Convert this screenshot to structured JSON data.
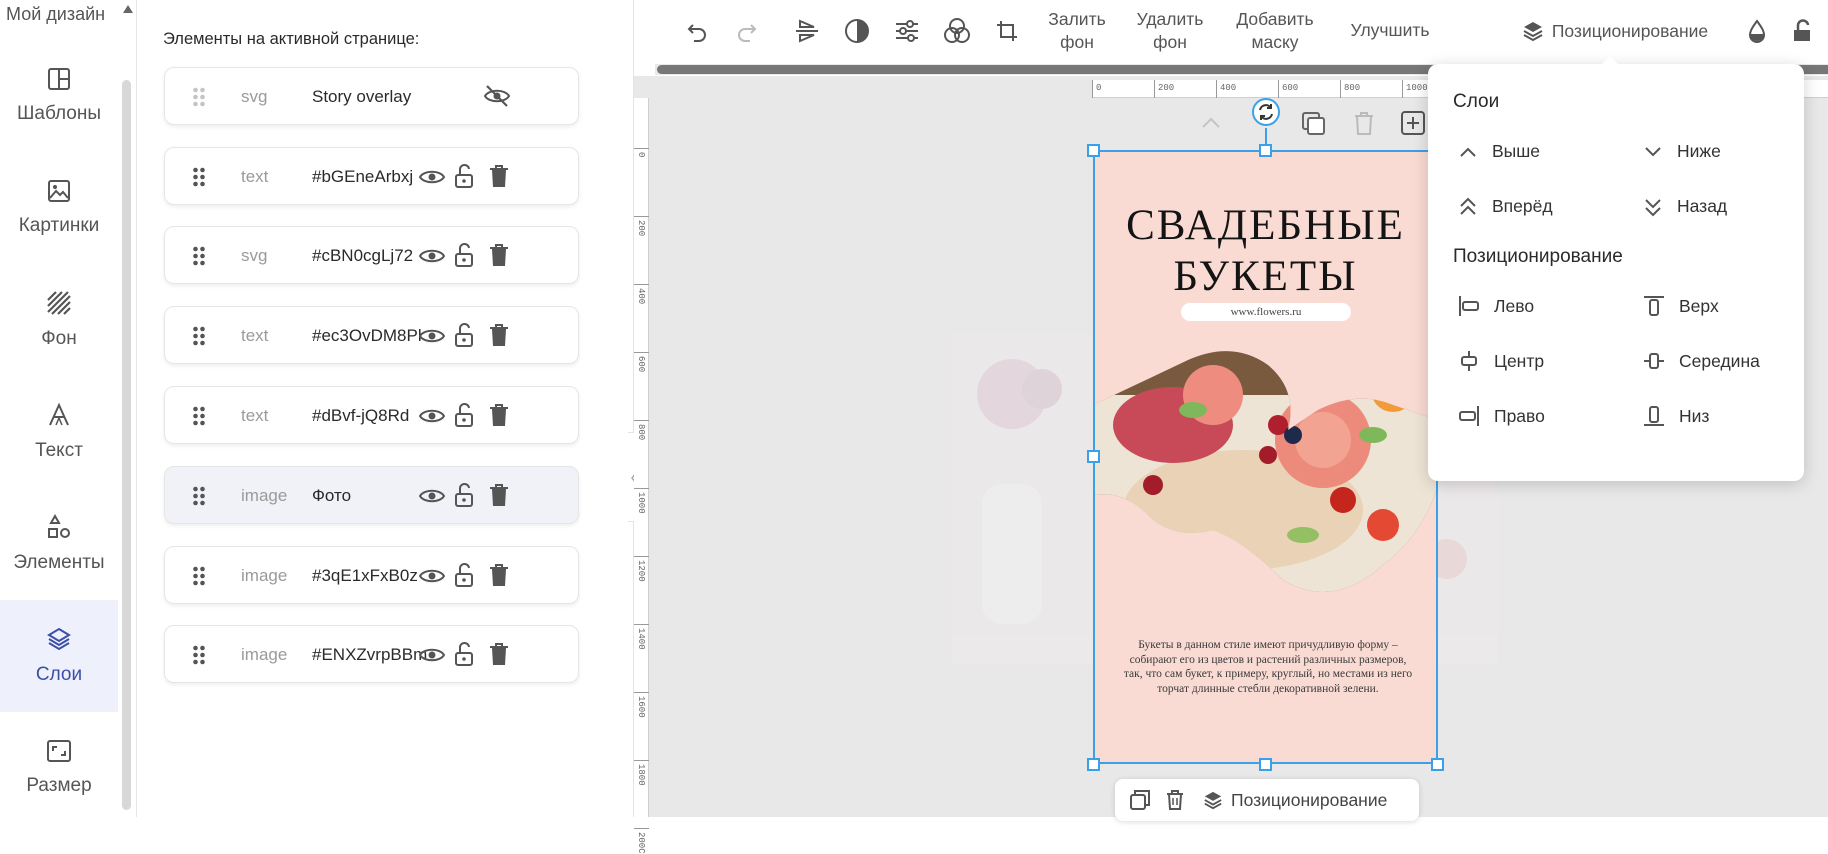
{
  "brand": "Мой дизайн",
  "nav": [
    {
      "label": "Шаблоны",
      "icon": "templates-icon"
    },
    {
      "label": "Картинки",
      "icon": "image-icon"
    },
    {
      "label": "Фон",
      "icon": "background-icon"
    },
    {
      "label": "Текст",
      "icon": "text-icon"
    },
    {
      "label": "Элементы",
      "icon": "shapes-icon"
    },
    {
      "label": "Слои",
      "icon": "layers-icon",
      "active": true
    },
    {
      "label": "Размер",
      "icon": "resize-icon"
    }
  ],
  "panel": {
    "title": "Элементы на активной странице:",
    "layers": [
      {
        "type": "svg",
        "name": "Story overlay",
        "hidden": true
      },
      {
        "type": "text",
        "name": "#bGEneArbxj"
      },
      {
        "type": "svg",
        "name": "#cBN0cgLj72"
      },
      {
        "type": "text",
        "name": "#ec3OvDM8Pl"
      },
      {
        "type": "text",
        "name": "#dBvf-jQ8Rd"
      },
      {
        "type": "image",
        "name": "Фото",
        "selected": true
      },
      {
        "type": "image",
        "name": "#3qE1xFxB0z"
      },
      {
        "type": "image",
        "name": "#ENXZvrpBBm"
      }
    ]
  },
  "toolbar": {
    "fill_bg_1": "Залить",
    "fill_bg_2": "фон",
    "remove_bg_1": "Удалить",
    "remove_bg_2": "фон",
    "add_mask_1": "Добавить",
    "add_mask_2": "маску",
    "improve": "Улучшить",
    "positioning": "Позиционирование"
  },
  "ruler": {
    "top": [
      "0",
      "200",
      "400",
      "600",
      "800",
      "1000"
    ],
    "left": [
      "0",
      "200",
      "400",
      "600",
      "800",
      "1000",
      "1200",
      "1400",
      "1600",
      "1800",
      "200C"
    ]
  },
  "design": {
    "title_line1": "СВАДЕБНЫЕ",
    "title_line2": "БУКЕТЫ",
    "url": "www.flowers.ru",
    "body": "Букеты в данном стиле имеют причудливую форму – собирают его из цветов и растений различных размеров, так, что сам букет, к примеру, круглый, но местами из него торчат длинные стебли декоративной зелени."
  },
  "floating": {
    "positioning": "Позиционирование"
  },
  "dropdown": {
    "layers_heading": "Слои",
    "up": "Выше",
    "down": "Ниже",
    "forward": "Вперёд",
    "back": "Назад",
    "pos_heading": "Позиционирование",
    "left": "Лево",
    "top": "Верх",
    "center": "Центр",
    "middle": "Середина",
    "right": "Право",
    "bottom": "Низ"
  },
  "colors": {
    "accent": "#3b4fa8",
    "selection": "#3aa0e8",
    "artboard": "#f9dbd4"
  }
}
